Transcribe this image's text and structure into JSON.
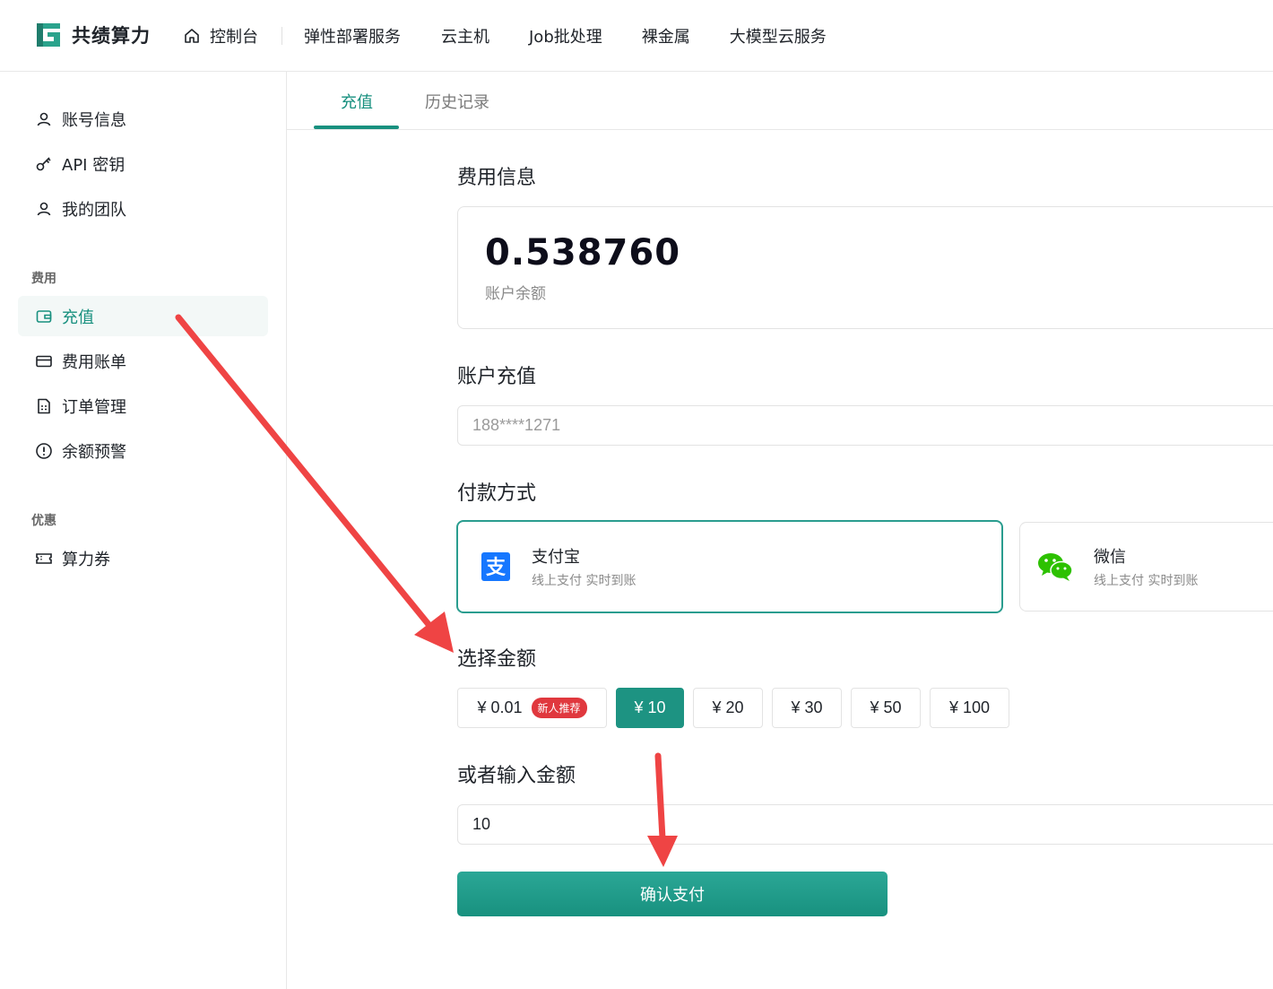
{
  "brand": {
    "name": "共绩算力",
    "accent": "#18907f"
  },
  "nav": {
    "home_label": "控制台",
    "items": [
      "弹性部署服务",
      "云主机",
      "Job批处理",
      "裸金属",
      "大模型云服务"
    ]
  },
  "sidebar": {
    "account_items": [
      {
        "label": "账号信息",
        "icon": "user-icon"
      },
      {
        "label": "API 密钥",
        "icon": "key-icon"
      },
      {
        "label": "我的团队",
        "icon": "team-icon"
      }
    ],
    "billing_group": "费用",
    "billing_items": [
      {
        "label": "充值",
        "icon": "wallet-icon"
      },
      {
        "label": "费用账单",
        "icon": "card-icon"
      },
      {
        "label": "订单管理",
        "icon": "document-icon"
      },
      {
        "label": "余额预警",
        "icon": "alert-icon"
      }
    ],
    "promo_group": "优惠",
    "promo_items": [
      {
        "label": "算力券",
        "icon": "ticket-icon"
      }
    ]
  },
  "tabs": [
    "充值",
    "历史记录"
  ],
  "fee_info": {
    "title": "费用信息",
    "balance": "0.538760",
    "balance_label": "账户余额"
  },
  "recharge": {
    "title": "账户充值",
    "account": "188****1271"
  },
  "payment": {
    "title": "付款方式",
    "methods": [
      {
        "name": "支付宝",
        "desc": "线上支付 实时到账",
        "icon": "alipay-icon"
      },
      {
        "name": "微信",
        "desc": "线上支付 实时到账",
        "icon": "wechat-icon"
      }
    ]
  },
  "amount": {
    "title": "选择金额",
    "options": [
      "¥ 0.01",
      "¥ 10",
      "¥ 20",
      "¥ 30",
      "¥ 50",
      "¥ 100"
    ],
    "badge": "新人推荐",
    "selected": "¥ 10",
    "custom_title": "或者输入金额",
    "custom_value": "10"
  },
  "confirm_label": "确认支付"
}
